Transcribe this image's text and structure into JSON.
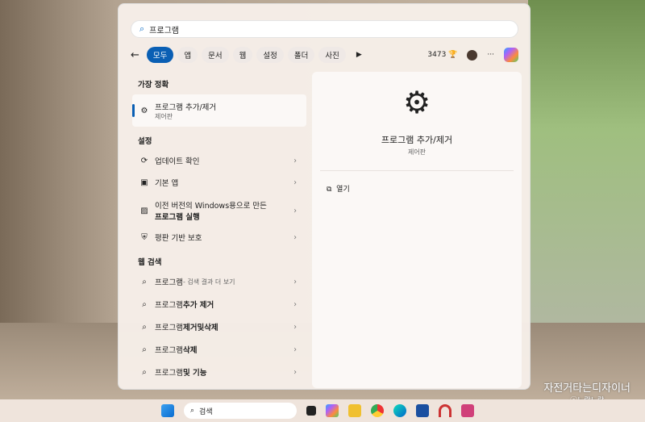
{
  "search": {
    "query": "프로그램"
  },
  "filters": {
    "back": "←",
    "chips": [
      "모두",
      "앱",
      "문서",
      "웹",
      "설정",
      "폴더",
      "사진"
    ],
    "more": "▶",
    "points": "3473",
    "ellipsis": "···"
  },
  "best_match": {
    "heading": "가장 정확",
    "title": "프로그램 추가/제거",
    "subtitle": "제어판"
  },
  "settings": {
    "heading": "설정",
    "items": [
      "업데이트 확인",
      "기본 앱",
      "이전 버전의 Windows용으로 만든",
      "프로그램 실행",
      "평판 기반 보호"
    ]
  },
  "web": {
    "heading": "웹 검색",
    "items": [
      {
        "query": "프로그램",
        "extra": " - 검색 결과 더 보기"
      },
      {
        "query": "프로그램",
        "extra": " 추가 제거"
      },
      {
        "query": "프로그램",
        "extra": "제거및삭제"
      },
      {
        "query": "프로그램",
        "extra": "삭제"
      },
      {
        "query": "프로그램",
        "extra": " 및 기능"
      }
    ]
  },
  "detail": {
    "title": "프로그램 추가/제거",
    "subtitle": "제어판",
    "action": "열기"
  },
  "taskbar": {
    "search_placeholder": "검색"
  },
  "watermark": {
    "title": "자전거타는디자이너",
    "credit": "ⓒ노랄노랄"
  }
}
